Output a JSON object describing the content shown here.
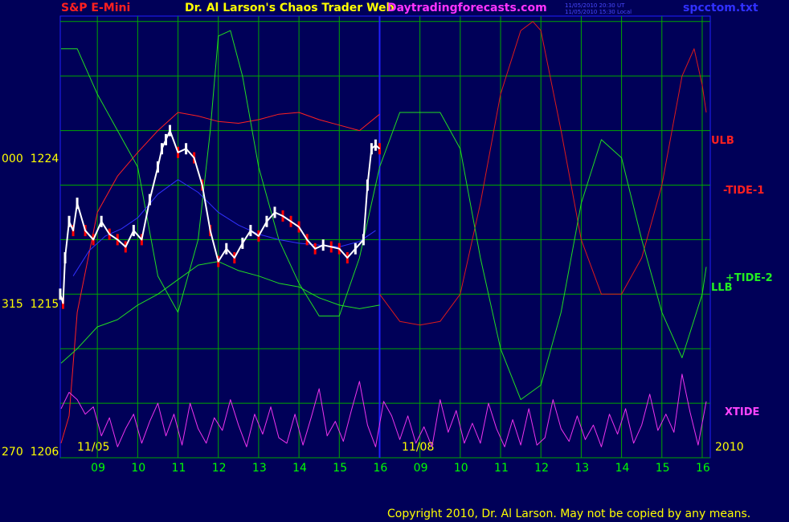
{
  "header": {
    "symbol": "S&P E-Mini",
    "title": "Dr. Al Larson's Chaos Trader Web",
    "site": "Daytradingforecasts.com",
    "timestamp_ut": "11/05/2010 20:30 UT",
    "timestamp_local": "11/05/2010 15:30 Local",
    "file": "spcctom.txt"
  },
  "copyright": "Copyright 2010, Dr. Al Larson. May not be copied by any means.",
  "colors": {
    "background": "#000058",
    "grid": "#00a800",
    "price": "#ffffff",
    "price_down": "#ff0000",
    "ulb": "#ff2020",
    "tide1": "#dd1a1a",
    "tide2": "#22dd22",
    "llb": "#22dd22",
    "xtide": "#ee33ee",
    "avg": "#3030ff",
    "axis_text": "#ffff00",
    "hour_text": "#00ff00",
    "divider": "#2020ff"
  },
  "chart_data": {
    "type": "line",
    "y_axis": {
      "ticks": [
        {
          "left": "000",
          "value": "1224"
        },
        {
          "left": "315",
          "value": "1215"
        },
        {
          "left": "270",
          "value": "1206"
        }
      ],
      "ylim": [
        1206,
        1230.3
      ]
    },
    "x_axis": {
      "dates": [
        {
          "label": "11/05",
          "at_hour": 8.7
        },
        {
          "label": "11/08",
          "at_hour": 16.5
        },
        {
          "label": "2010",
          "at_hour": 24.3
        }
      ],
      "hour_ticks": [
        "09",
        "10",
        "11",
        "12",
        "13",
        "14",
        "15",
        "16",
        "09",
        "10",
        "11",
        "12",
        "13",
        "14",
        "15",
        "16"
      ],
      "hour_tick_positions": [
        9,
        10,
        11,
        12,
        13,
        14,
        15,
        16,
        17,
        18,
        19,
        20,
        21,
        22,
        23,
        24
      ],
      "xlim": [
        8.08,
        24.2
      ],
      "divider_at": 16.0
    },
    "grid": true,
    "series": [
      {
        "name": "ULB",
        "color_key": "ulb",
        "x": [
          8.1,
          8.3,
          8.5,
          9,
          9.5,
          10,
          10.5,
          11,
          11.5,
          12,
          12.5,
          13,
          13.5,
          14,
          14.5,
          15,
          15.5,
          16
        ],
        "y": [
          1206.8,
          1208.3,
          1214,
          1219.5,
          1221.5,
          1222.8,
          1224,
          1225,
          1224.8,
          1224.5,
          1224.4,
          1224.6,
          1224.9,
          1225,
          1224.6,
          1224.3,
          1224,
          1224.9
        ]
      },
      {
        "name": "-TIDE-1",
        "color_key": "tide1",
        "x": [
          16,
          16.5,
          17,
          17.5,
          18,
          18.5,
          19,
          19.5,
          19.8,
          20,
          20.5,
          21,
          21.5,
          22,
          22.5,
          23,
          23.5,
          23.8,
          24,
          24.1
        ],
        "y": [
          1215,
          1213.5,
          1213.3,
          1213.5,
          1215,
          1220,
          1226,
          1229.5,
          1230,
          1229.5,
          1224,
          1218,
          1215,
          1215,
          1217,
          1221,
          1227,
          1228.5,
          1226.5,
          1225
        ]
      },
      {
        "name": "+TIDE-2",
        "color_key": "tide2",
        "x": [
          8.1,
          8.5,
          9,
          9.5,
          10,
          10.5,
          11,
          11.5,
          11.8,
          12,
          12.3,
          12.6,
          13,
          13.5,
          14,
          14.5,
          15,
          15.5,
          16,
          16.5,
          17,
          17.5,
          18,
          18.5,
          19,
          19.5,
          20,
          20.5,
          21,
          21.5,
          22,
          22.5,
          23,
          23.5,
          24,
          24.1
        ],
        "y": [
          1228.5,
          1228.5,
          1226,
          1224,
          1222,
          1216,
          1214,
          1218,
          1224,
          1229.2,
          1229.5,
          1227,
          1222,
          1218,
          1215.6,
          1213.8,
          1213.8,
          1217,
          1222,
          1225,
          1225,
          1225,
          1223,
          1217,
          1212,
          1209.2,
          1210,
          1214,
          1220,
          1223.5,
          1222.5,
          1218,
          1214,
          1211.5,
          1215,
          1216.5
        ]
      },
      {
        "name": "LLB",
        "color_key": "llb",
        "x": [
          8.1,
          8.5,
          9,
          9.5,
          10,
          10.5,
          11,
          11.5,
          12,
          12.5,
          13,
          13.5,
          14,
          14.5,
          15,
          15.5,
          16
        ],
        "y": [
          1211.2,
          1212,
          1213.2,
          1213.6,
          1214.4,
          1215,
          1215.8,
          1216.6,
          1216.8,
          1216.3,
          1216.0,
          1215.6,
          1215.4,
          1214.8,
          1214.4,
          1214.2,
          1214.4
        ]
      },
      {
        "name": "avg",
        "color_key": "avg",
        "x": [
          8.4,
          8.8,
          9.2,
          9.6,
          10,
          10.5,
          11,
          11.5,
          12,
          12.5,
          13,
          13.5,
          14,
          14.5,
          15,
          15.5,
          15.9
        ],
        "y": [
          1216,
          1217.4,
          1218.2,
          1218.6,
          1219.2,
          1220.5,
          1221.3,
          1220.6,
          1219.5,
          1218.8,
          1218.3,
          1218.0,
          1217.8,
          1217.7,
          1217.6,
          1217.9,
          1218.5
        ]
      },
      {
        "name": "price",
        "color_key": "price",
        "x": [
          8.08,
          8.15,
          8.2,
          8.3,
          8.4,
          8.5,
          8.7,
          8.9,
          9.1,
          9.3,
          9.5,
          9.7,
          9.9,
          10.1,
          10.3,
          10.5,
          10.6,
          10.7,
          10.8,
          11,
          11.2,
          11.4,
          11.6,
          11.8,
          12,
          12.2,
          12.4,
          12.6,
          12.8,
          13,
          13.2,
          13.4,
          13.6,
          13.8,
          14,
          14.2,
          14.4,
          14.6,
          14.8,
          15,
          15.2,
          15.4,
          15.6,
          15.7,
          15.8,
          15.9,
          16
        ],
        "y": [
          1215,
          1214.5,
          1217,
          1219,
          1218.5,
          1220,
          1218.5,
          1218,
          1219,
          1218.3,
          1218,
          1217.6,
          1218.5,
          1218,
          1220.2,
          1222,
          1223,
          1223.5,
          1224,
          1222.8,
          1223,
          1222.5,
          1221,
          1218.5,
          1216.8,
          1217.5,
          1217,
          1217.8,
          1218.5,
          1218.2,
          1219,
          1219.5,
          1219.3,
          1219,
          1218.7,
          1218,
          1217.5,
          1217.7,
          1217.6,
          1217.5,
          1217,
          1217.5,
          1218,
          1221,
          1223,
          1223.2,
          1223
        ]
      },
      {
        "name": "XTIDE",
        "color_key": "xtide",
        "x": [
          8.1,
          8.3,
          8.5,
          8.7,
          8.9,
          9.1,
          9.3,
          9.5,
          9.7,
          9.9,
          10.1,
          10.3,
          10.5,
          10.7,
          10.9,
          11.1,
          11.3,
          11.5,
          11.7,
          11.9,
          12.1,
          12.3,
          12.5,
          12.7,
          12.9,
          13.1,
          13.3,
          13.5,
          13.7,
          13.9,
          14.1,
          14.3,
          14.5,
          14.7,
          14.9,
          15.1,
          15.3,
          15.5,
          15.7,
          15.9,
          16.1,
          16.3,
          16.5,
          16.7,
          16.9,
          17.1,
          17.3,
          17.5,
          17.7,
          17.9,
          18.1,
          18.3,
          18.5,
          18.7,
          18.9,
          19.1,
          19.3,
          19.5,
          19.7,
          19.9,
          20.1,
          20.3,
          20.5,
          20.7,
          20.9,
          21.1,
          21.3,
          21.5,
          21.7,
          21.9,
          22.1,
          22.3,
          22.5,
          22.7,
          22.9,
          23.1,
          23.3,
          23.5,
          23.7,
          23.9,
          24.1
        ],
        "y": [
          1208.7,
          1209.6,
          1209.2,
          1208.4,
          1208.8,
          1207.2,
          1208.2,
          1206.6,
          1207.6,
          1208.4,
          1206.8,
          1208,
          1209,
          1207.2,
          1208.4,
          1206.7,
          1209,
          1207.6,
          1206.8,
          1208.2,
          1207.5,
          1209.2,
          1207.8,
          1206.6,
          1208.4,
          1207.3,
          1208.8,
          1207.1,
          1206.8,
          1208.4,
          1206.7,
          1208.2,
          1209.8,
          1207.2,
          1208,
          1206.9,
          1208.6,
          1210.2,
          1207.8,
          1206.6,
          1209.1,
          1208.3,
          1207,
          1208.3,
          1206.8,
          1207.7,
          1206.6,
          1209.2,
          1207.4,
          1208.6,
          1206.8,
          1207.9,
          1206.8,
          1209.0,
          1207.6,
          1206.6,
          1208.1,
          1206.7,
          1208.7,
          1206.7,
          1207.1,
          1209.2,
          1207.6,
          1206.9,
          1208.3,
          1207.0,
          1207.8,
          1206.6,
          1208.4,
          1207.3,
          1208.7,
          1206.8,
          1207.8,
          1209.5,
          1207.5,
          1208.4,
          1207.4,
          1210.6,
          1208.5,
          1206.7,
          1209.1
        ]
      }
    ],
    "labels": {
      "ULB": "ULB",
      "TIDE1": "-TIDE-1",
      "TIDE2": "+TIDE-2",
      "LLB": "LLB",
      "XTIDE": "XTIDE"
    }
  }
}
